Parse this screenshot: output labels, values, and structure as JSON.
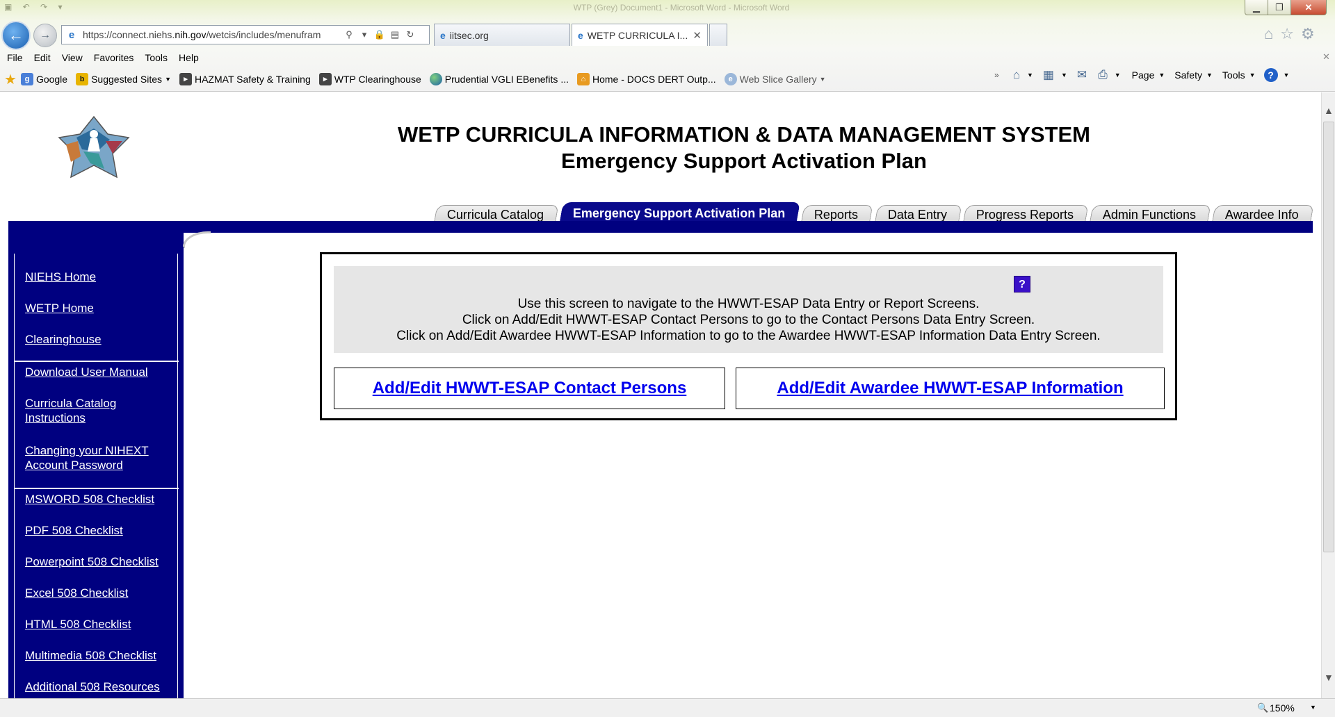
{
  "window": {
    "title": "WTP (Grey) Document1 - Microsoft Word - Microsoft Word"
  },
  "browser": {
    "url_prefix": "https://connect.niehs.",
    "url_domain": "nih.gov",
    "url_suffix": "/wetcis/includes/menufram",
    "tabs": [
      {
        "label": "iitsec.org"
      },
      {
        "label": "WETP CURRICULA I..."
      }
    ],
    "menu": [
      "File",
      "Edit",
      "View",
      "Favorites",
      "Tools",
      "Help"
    ],
    "favorites": [
      {
        "label": "Google",
        "icon": "google-icon"
      },
      {
        "label": "Suggested Sites",
        "icon": "bing-icon"
      },
      {
        "label": "HAZMAT Safety & Training",
        "icon": "document-icon"
      },
      {
        "label": "WTP Clearinghouse",
        "icon": "document-icon"
      },
      {
        "label": "Prudential VGLI  EBenefits ...",
        "icon": "globe-icon"
      },
      {
        "label": "Home - DOCS DERT Outp...",
        "icon": "home-icon"
      },
      {
        "label": "Web Slice Gallery",
        "icon": "web-slice-icon"
      }
    ],
    "commands": {
      "page": "Page",
      "safety": "Safety",
      "tools": "Tools"
    },
    "zoom": "150%"
  },
  "header": {
    "title": "WETP CURRICULA INFORMATION & DATA MANAGEMENT SYSTEM",
    "subtitle": "Emergency Support Activation Plan"
  },
  "tabs": [
    {
      "label": "Curricula Catalog"
    },
    {
      "label": "Emergency Support Activation Plan",
      "active": true
    },
    {
      "label": "Reports"
    },
    {
      "label": "Data Entry"
    },
    {
      "label": "Progress Reports"
    },
    {
      "label": "Admin Functions"
    },
    {
      "label": "Awardee Info"
    }
  ],
  "sidebar": {
    "links": [
      "NIEHS Home",
      "WETP Home",
      "Clearinghouse",
      "Download User Manual",
      "Curricula Catalog Instructions",
      "Changing your NIHEXT Account Password",
      "MSWORD 508 Checklist",
      "PDF 508 Checklist",
      "Powerpoint 508 Checklist",
      "Excel 508 Checklist",
      "HTML 508 Checklist",
      "Multimedia 508 Checklist",
      "Additional 508 Resources"
    ]
  },
  "main": {
    "help_label": "?",
    "instructions": [
      "Use this screen to navigate to the HWWT-ESAP Data Entry or Report Screens.",
      "Click on Add/Edit HWWT-ESAP Contact Persons to go to the Contact Persons Data Entry Screen.",
      "Click on Add/Edit Awardee HWWT-ESAP Information to go to the Awardee HWWT-ESAP Information Data Entry Screen."
    ],
    "contacts_link": "Add/Edit HWWT-ESAP Contact Persons",
    "awardee_link": "Add/Edit Awardee HWWT-ESAP Information"
  }
}
